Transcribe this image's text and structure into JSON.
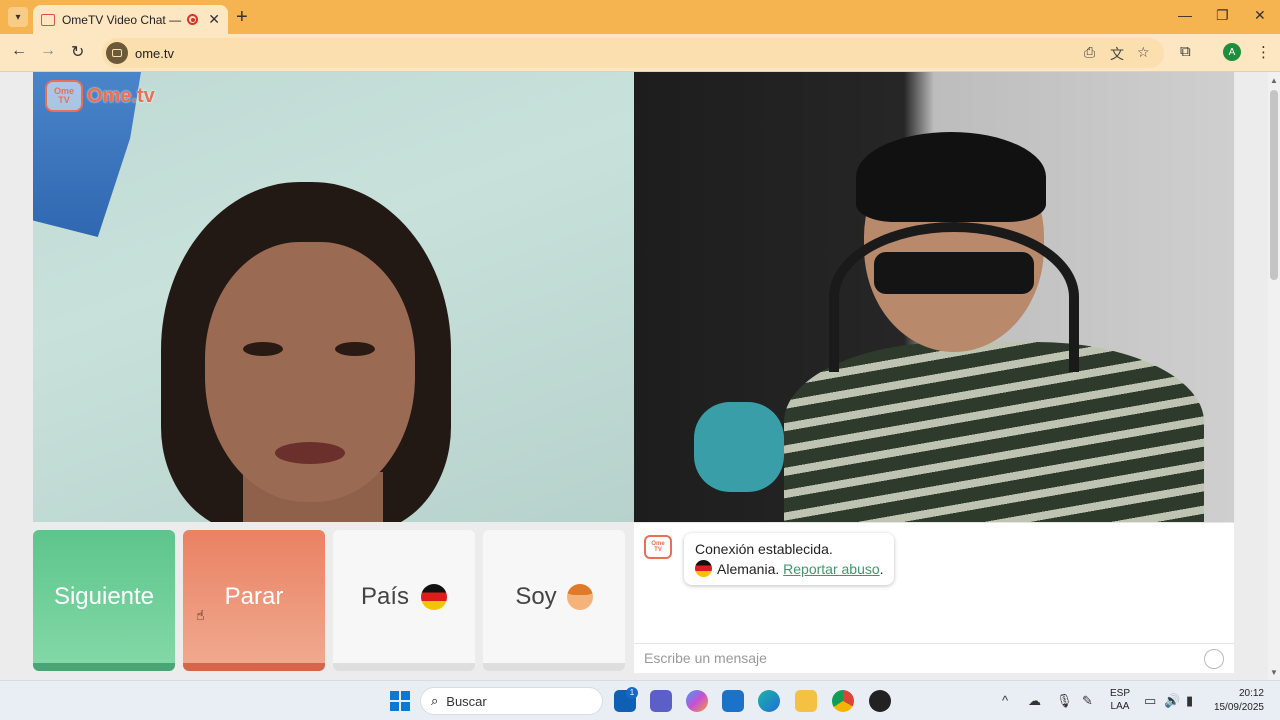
{
  "browser": {
    "tab_title": "OmeTV Video Chat — Ome",
    "url": "ome.tv",
    "profile_initial": "A",
    "accent": "#f6b451"
  },
  "app": {
    "logo_text": "Ome.tv",
    "logo_badge_top": "Ome",
    "logo_badge_bottom": "TV",
    "buttons": {
      "next": "Siguiente",
      "stop": "Parar",
      "country": "País",
      "gender": "Soy"
    },
    "chat": {
      "status": "Conexión establecida.",
      "country": "Alemania.",
      "report": "Reportar abuso",
      "trailing": ".",
      "placeholder": "Escribe un mensaje"
    },
    "colors": {
      "next": "#5dc58c",
      "stop": "#ea8163",
      "brand": "#e96f55"
    }
  },
  "taskbar": {
    "search_label": "Buscar",
    "lang_top": "ESP",
    "lang_bottom": "LAA",
    "time": "20:12",
    "date": "15/09/2025",
    "teams_badge": "1"
  }
}
